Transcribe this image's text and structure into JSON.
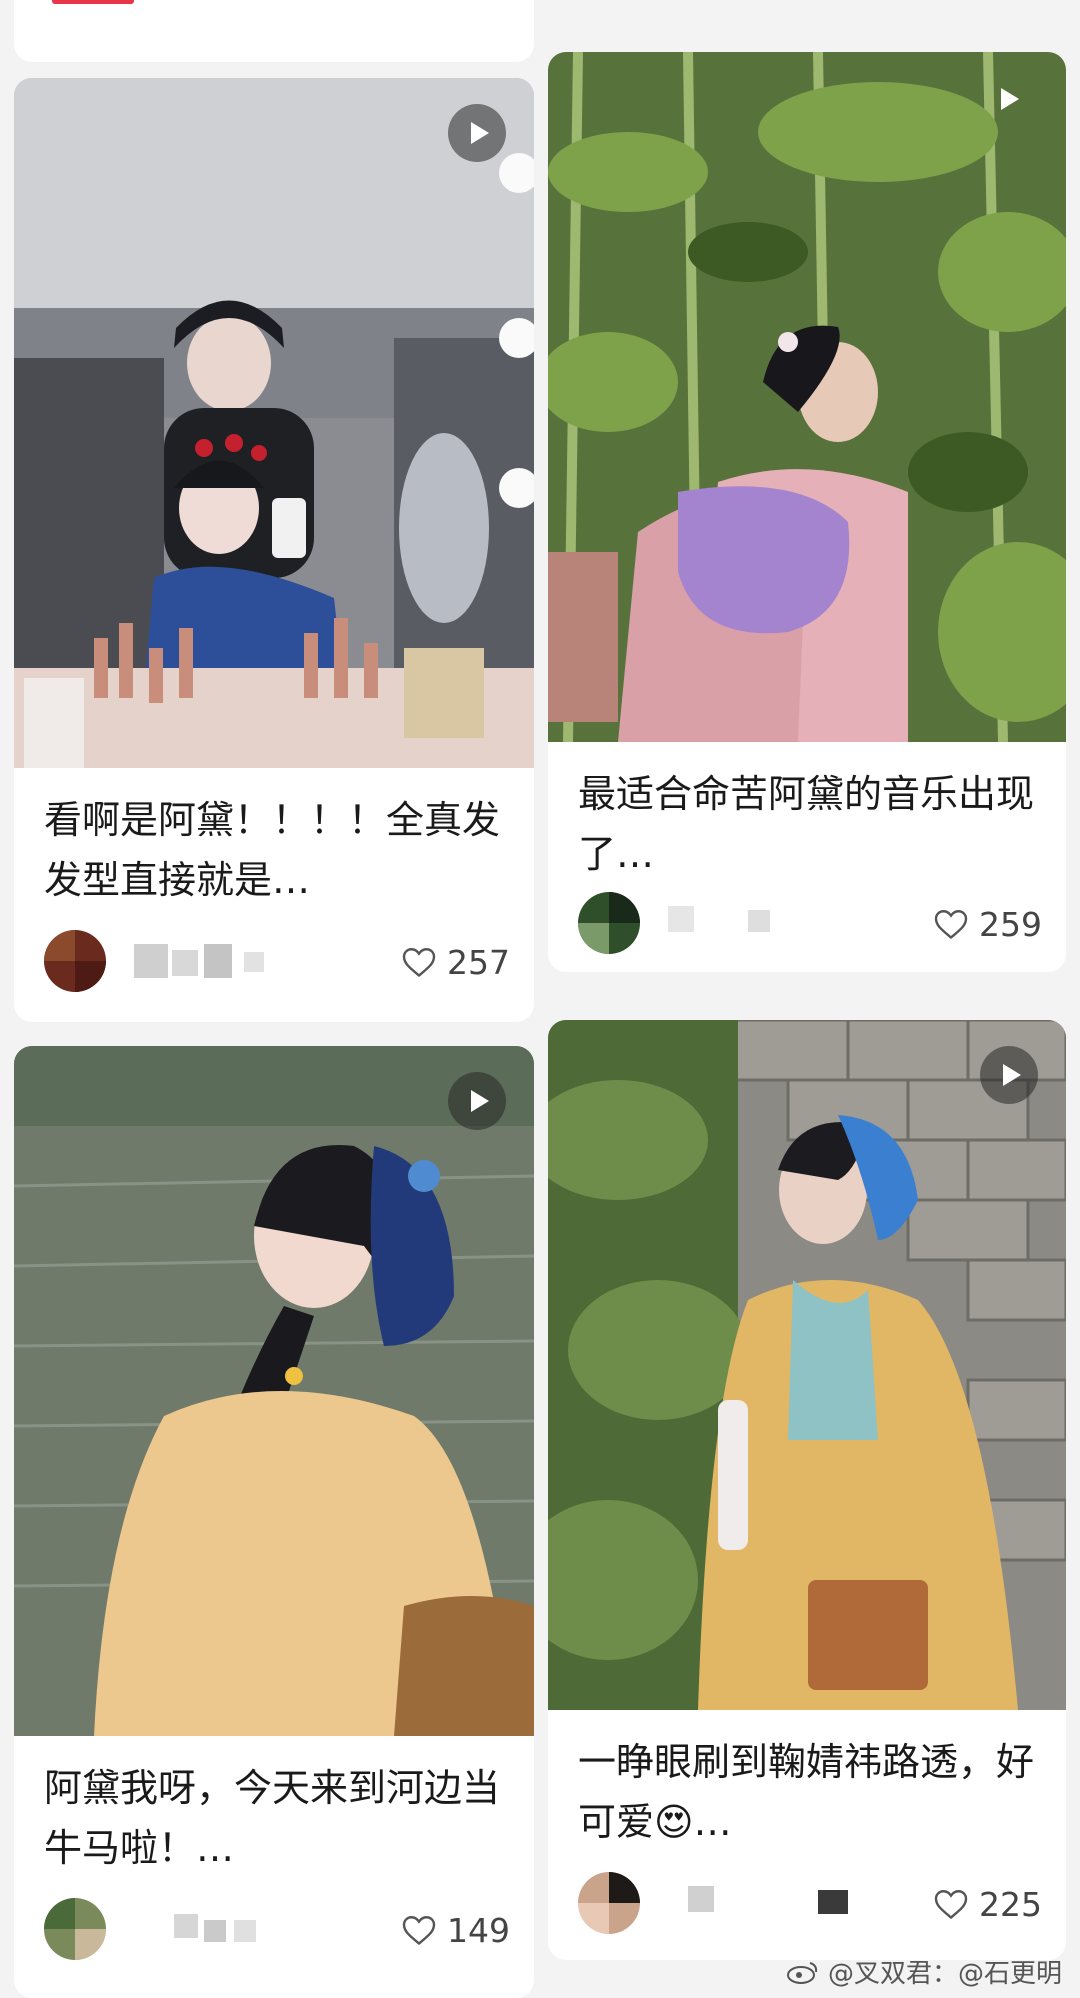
{
  "feed": {
    "cards": [
      {
        "title": "看啊是阿黛！！！！全真发发型直接就是…",
        "likes": "257"
      },
      {
        "title": "最适合命苦阿黛的音乐出现了…",
        "likes": "259"
      },
      {
        "title": "阿黛我呀，今天来到河边当牛马啦！…",
        "likes": "149"
      },
      {
        "title": "一睁眼刷到鞠婧祎路透，好可爱😍…",
        "likes": "225"
      }
    ]
  },
  "watermark": {
    "text": "@叉双君：@石更明"
  },
  "colors": {
    "accent": "#e8354a",
    "card": "#ffffff",
    "background": "#f3f3f3"
  }
}
